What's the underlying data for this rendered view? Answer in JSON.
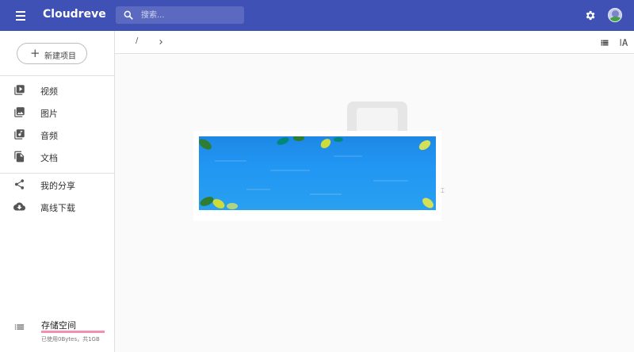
{
  "app": {
    "title": "Cloudreve"
  },
  "search": {
    "placeholder": "搜索..."
  },
  "sidebar": {
    "new_button": "新建项目",
    "items": [
      {
        "label": "视频",
        "icon": "video-library-icon"
      },
      {
        "label": "图片",
        "icon": "photo-library-icon"
      },
      {
        "label": "音频",
        "icon": "library-music-icon"
      },
      {
        "label": "文档",
        "icon": "file-copy-icon"
      },
      {
        "label": "我的分享",
        "icon": "share-icon"
      },
      {
        "label": "离线下载",
        "icon": "cloud-download-icon"
      }
    ],
    "storage": {
      "title": "存储空间",
      "info": "已使用0Bytes，共1GB",
      "used_fraction": 0
    }
  },
  "breadcrumb": {
    "root": "/"
  },
  "colors": {
    "primary": "#3f51b5",
    "storage_bar": "#f48fb1",
    "ad_blue": "#2196f3"
  }
}
